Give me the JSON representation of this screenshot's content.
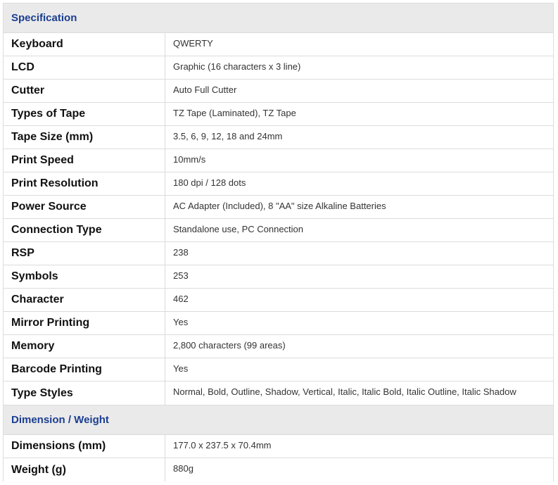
{
  "sections": [
    {
      "title": "Specification",
      "rows": [
        {
          "label": "Keyboard",
          "value": "QWERTY"
        },
        {
          "label": "LCD",
          "value": "Graphic (16 characters x 3 line)"
        },
        {
          "label": "Cutter",
          "value": "Auto Full Cutter"
        },
        {
          "label": "Types of Tape",
          "value": "TZ Tape (Laminated), TZ Tape"
        },
        {
          "label": "Tape Size (mm)",
          "value": "3.5, 6, 9, 12, 18 and 24mm"
        },
        {
          "label": "Print Speed",
          "value": "10mm/s"
        },
        {
          "label": "Print Resolution",
          "value": "180 dpi / 128 dots"
        },
        {
          "label": "Power Source",
          "value": "AC Adapter (Included), 8 \"AA\" size Alkaline Batteries"
        },
        {
          "label": "Connection Type",
          "value": "Standalone use, PC Connection"
        },
        {
          "label": "RSP",
          "value": "238"
        },
        {
          "label": "Symbols",
          "value": "253"
        },
        {
          "label": "Character",
          "value": "462"
        },
        {
          "label": "Mirror Printing",
          "value": "Yes"
        },
        {
          "label": "Memory",
          "value": "2,800 characters (99 areas)"
        },
        {
          "label": "Barcode Printing",
          "value": "Yes"
        },
        {
          "label": "Type Styles",
          "value": "Normal, Bold, Outline, Shadow, Vertical, Italic, Italic Bold, Italic Outline, Italic Shadow"
        }
      ]
    },
    {
      "title": "Dimension / Weight",
      "rows": [
        {
          "label": "Dimensions (mm)",
          "value": "177.0 x 237.5 x 70.4mm"
        },
        {
          "label": "Weight (g)",
          "value": "880g"
        }
      ]
    }
  ]
}
